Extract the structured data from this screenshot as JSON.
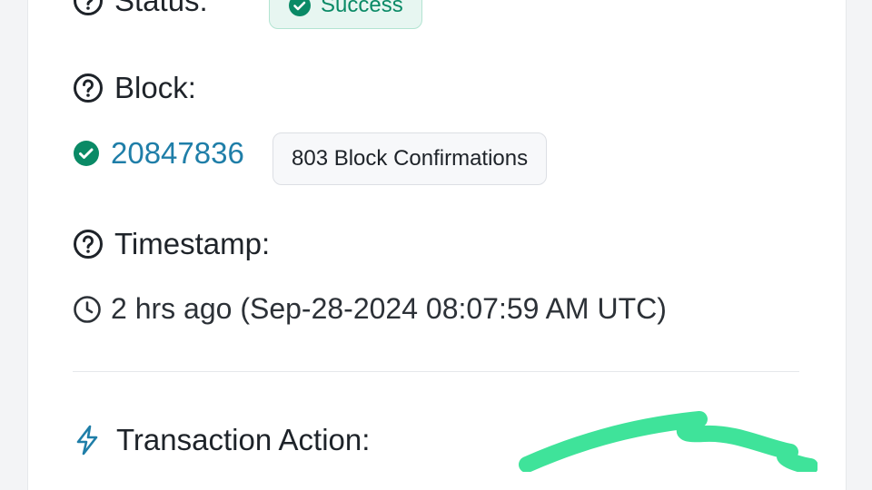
{
  "colors": {
    "success_bg": "#e7f6f1",
    "success_text": "#0a8a66",
    "link": "#1f7ea8",
    "scribble": "#3fe39a"
  },
  "status": {
    "label": "Status:",
    "icon": "question-circle-icon",
    "badge_text": "Success",
    "badge_icon": "check-circle-icon"
  },
  "block": {
    "label": "Block:",
    "icon": "question-circle-icon",
    "number": "20847836",
    "confirmations": "803 Block Confirmations"
  },
  "timestamp": {
    "label": "Timestamp:",
    "icon": "question-circle-icon",
    "value": "2 hrs ago (Sep-28-2024 08:07:59 AM UTC)",
    "value_icon": "clock-icon"
  },
  "transaction_action": {
    "label": "Transaction Action:",
    "icon": "lightning-icon"
  }
}
